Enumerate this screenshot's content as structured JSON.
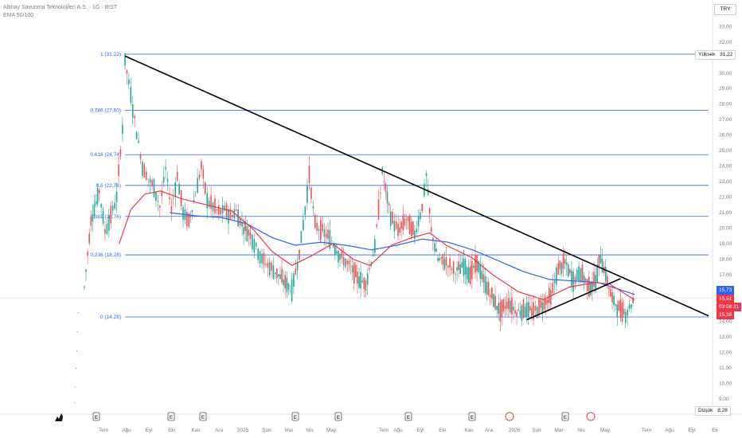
{
  "header": {
    "symbol_line": "Altinay Savunma Teknolojileri A.S. · 1G · BIST",
    "indicator_line": "EMA 50/100"
  },
  "currency": "TRY",
  "price_axis": {
    "ticks": [
      "33,00",
      "32,00",
      "31,00",
      "30,00",
      "29,00",
      "28,00",
      "27,00",
      "26,00",
      "25,00",
      "24,00",
      "23,00",
      "22,00",
      "21,00",
      "20,00",
      "19,00",
      "18,00",
      "17,00",
      "16,00",
      "15,00",
      "14,00",
      "13,00",
      "12,00",
      "11,00",
      "10,00",
      "9,00"
    ]
  },
  "time_axis": {
    "labels": [
      "Tem",
      "Ağu",
      "Eyl",
      "Ekí",
      "Kas",
      "Ara",
      "2025",
      "Şub",
      "Mar",
      "Nis",
      "May",
      "Tem",
      "Ağu",
      "Eyl",
      "Ekí",
      "Kas",
      "Ara",
      "2026",
      "Şub",
      "Mar",
      "Nis",
      "May",
      "Tem",
      "Ağu",
      "Eyl",
      "Ek"
    ]
  },
  "extremes": {
    "high_label": "Yüksek",
    "high_value": "31,22",
    "low_label": "Düşük",
    "low_value": "8,28"
  },
  "price_tags": {
    "ema100": "15,73",
    "last": "15,51",
    "countdown": "03:56:21",
    "ema50": "15,38"
  },
  "colors": {
    "fib": "#2962ff",
    "fib_text": "#2962ff",
    "up": "#26a69a",
    "down": "#ef5350",
    "ema50": "#f23645",
    "ema100": "#2962ff",
    "trendline": "#000000",
    "axis_text": "#787b86"
  },
  "chart_data": {
    "type": "candlestick",
    "title": "",
    "xlabel": "",
    "ylabel": "",
    "ylim": [
      8.28,
      33.0
    ],
    "grid": false,
    "fib_levels": [
      {
        "label": "1 (31,22)",
        "price": 31.22
      },
      {
        "label": "0,786 (27,60)",
        "price": 27.6
      },
      {
        "label": "0,618 (24,74)",
        "price": 24.74
      },
      {
        "label": "0,5 (22,76)",
        "price": 22.76
      },
      {
        "label": "0,382 (20,76)",
        "price": 20.76
      },
      {
        "label": "0,236 (18,28)",
        "price": 18.28
      },
      {
        "label": "0 (14,28)",
        "price": 14.28
      }
    ],
    "close_series": [
      [
        "2024-06-20",
        16.2
      ],
      [
        "2024-06-28",
        20.5
      ],
      [
        "2024-07-08",
        22.4
      ],
      [
        "2024-07-15",
        19.8
      ],
      [
        "2024-07-22",
        20.8
      ],
      [
        "2024-07-29",
        22.0
      ],
      [
        "2024-08-05",
        26.5
      ],
      [
        "2024-08-08",
        30.8
      ],
      [
        "2024-08-15",
        28.6
      ],
      [
        "2024-08-22",
        26.2
      ],
      [
        "2024-08-29",
        24.0
      ],
      [
        "2024-09-05",
        23.2
      ],
      [
        "2024-09-12",
        22.6
      ],
      [
        "2024-09-19",
        21.4
      ],
      [
        "2024-09-26",
        23.8
      ],
      [
        "2024-10-03",
        21.2
      ],
      [
        "2024-10-10",
        23.4
      ],
      [
        "2024-10-17",
        21.0
      ],
      [
        "2024-10-24",
        20.4
      ],
      [
        "2024-11-01",
        22.2
      ],
      [
        "2024-11-08",
        24.0
      ],
      [
        "2024-11-15",
        21.8
      ],
      [
        "2024-11-22",
        21.4
      ],
      [
        "2024-11-29",
        21.0
      ],
      [
        "2024-12-06",
        21.2
      ],
      [
        "2024-12-13",
        20.8
      ],
      [
        "2024-12-20",
        21.1
      ],
      [
        "2024-12-27",
        20.2
      ],
      [
        "2025-01-06",
        19.6
      ],
      [
        "2025-01-13",
        18.8
      ],
      [
        "2025-01-20",
        18.0
      ],
      [
        "2025-01-27",
        17.6
      ],
      [
        "2025-02-05",
        17.2
      ],
      [
        "2025-02-15",
        16.6
      ],
      [
        "2025-02-25",
        16.0
      ],
      [
        "2025-03-06",
        18.4
      ],
      [
        "2025-03-13",
        21.2
      ],
      [
        "2025-03-18",
        23.4
      ],
      [
        "2025-03-25",
        20.2
      ],
      [
        "2025-04-03",
        19.8
      ],
      [
        "2025-04-14",
        19.2
      ],
      [
        "2025-04-24",
        18.2
      ],
      [
        "2025-05-05",
        17.6
      ],
      [
        "2025-05-15",
        16.8
      ],
      [
        "2025-05-25",
        16.4
      ],
      [
        "2025-06-05",
        18.8
      ],
      [
        "2025-06-14",
        23.6
      ],
      [
        "2025-06-24",
        20.8
      ],
      [
        "2025-07-03",
        19.8
      ],
      [
        "2025-07-13",
        20.6
      ],
      [
        "2025-07-23",
        19.6
      ],
      [
        "2025-08-01",
        21.4
      ],
      [
        "2025-08-06",
        23.4
      ],
      [
        "2025-08-12",
        19.8
      ],
      [
        "2025-08-20",
        18.0
      ],
      [
        "2025-08-30",
        17.8
      ],
      [
        "2025-09-10",
        17.2
      ],
      [
        "2025-09-20",
        17.6
      ],
      [
        "2025-09-28",
        17.0
      ],
      [
        "2025-10-06",
        17.8
      ],
      [
        "2025-10-14",
        16.6
      ],
      [
        "2025-10-24",
        15.6
      ],
      [
        "2025-11-03",
        14.6
      ],
      [
        "2025-11-13",
        15.2
      ],
      [
        "2025-11-23",
        14.6
      ],
      [
        "2025-12-03",
        14.8
      ],
      [
        "2025-12-13",
        14.6
      ],
      [
        "2025-12-22",
        15.0
      ],
      [
        "2026-01-03",
        15.6
      ],
      [
        "2026-01-12",
        17.4
      ],
      [
        "2026-01-20",
        17.8
      ],
      [
        "2026-01-30",
        16.6
      ],
      [
        "2026-02-08",
        17.2
      ],
      [
        "2026-02-18",
        16.2
      ],
      [
        "2026-02-26",
        16.6
      ],
      [
        "2026-03-04",
        18.2
      ],
      [
        "2026-03-10",
        17.0
      ],
      [
        "2026-03-18",
        15.4
      ],
      [
        "2026-03-26",
        14.8
      ],
      [
        "2026-04-03",
        14.5
      ],
      [
        "2026-04-10",
        15.1
      ],
      [
        "2026-04-14",
        15.51
      ]
    ],
    "ema50": [
      [
        "2024-08-01",
        19.0
      ],
      [
        "2024-08-15",
        21.2
      ],
      [
        "2024-09-01",
        22.2
      ],
      [
        "2024-09-20",
        22.4
      ],
      [
        "2024-10-15",
        21.9
      ],
      [
        "2024-11-15",
        21.5
      ],
      [
        "2024-12-15",
        21.1
      ],
      [
        "2025-01-10",
        19.9
      ],
      [
        "2025-02-01",
        18.5
      ],
      [
        "2025-02-25",
        17.6
      ],
      [
        "2025-03-20",
        18.2
      ],
      [
        "2025-04-15",
        19.0
      ],
      [
        "2025-05-10",
        18.0
      ],
      [
        "2025-05-30",
        17.6
      ],
      [
        "2025-06-25",
        18.9
      ],
      [
        "2025-07-20",
        19.4
      ],
      [
        "2025-08-10",
        19.7
      ],
      [
        "2025-08-30",
        18.9
      ],
      [
        "2025-09-30",
        18.1
      ],
      [
        "2025-10-25",
        17.0
      ],
      [
        "2025-11-25",
        15.9
      ],
      [
        "2025-12-25",
        15.4
      ],
      [
        "2026-01-25",
        16.2
      ],
      [
        "2026-02-25",
        16.5
      ],
      [
        "2026-03-15",
        16.4
      ],
      [
        "2026-04-14",
        15.38
      ]
    ],
    "ema100": [
      [
        "2024-10-01",
        21.0
      ],
      [
        "2024-11-01",
        20.8
      ],
      [
        "2024-12-01",
        20.7
      ],
      [
        "2025-01-01",
        20.3
      ],
      [
        "2025-02-01",
        19.4
      ],
      [
        "2025-03-01",
        18.9
      ],
      [
        "2025-04-01",
        19.1
      ],
      [
        "2025-05-01",
        18.9
      ],
      [
        "2025-06-01",
        18.6
      ],
      [
        "2025-07-01",
        18.9
      ],
      [
        "2025-08-01",
        19.3
      ],
      [
        "2025-09-01",
        19.1
      ],
      [
        "2025-10-01",
        18.6
      ],
      [
        "2025-11-01",
        17.9
      ],
      [
        "2025-12-01",
        17.2
      ],
      [
        "2026-01-01",
        16.7
      ],
      [
        "2026-02-01",
        16.6
      ],
      [
        "2026-03-01",
        16.5
      ],
      [
        "2026-04-14",
        15.73
      ]
    ],
    "trendlines": [
      {
        "from": [
          "2024-08-08",
          31.1
        ],
        "to": [
          "2026-07-12",
          14.35
        ]
      },
      {
        "from": [
          "2025-12-05",
          14.1
        ],
        "to": [
          "2026-03-28",
          16.75
        ]
      }
    ]
  }
}
